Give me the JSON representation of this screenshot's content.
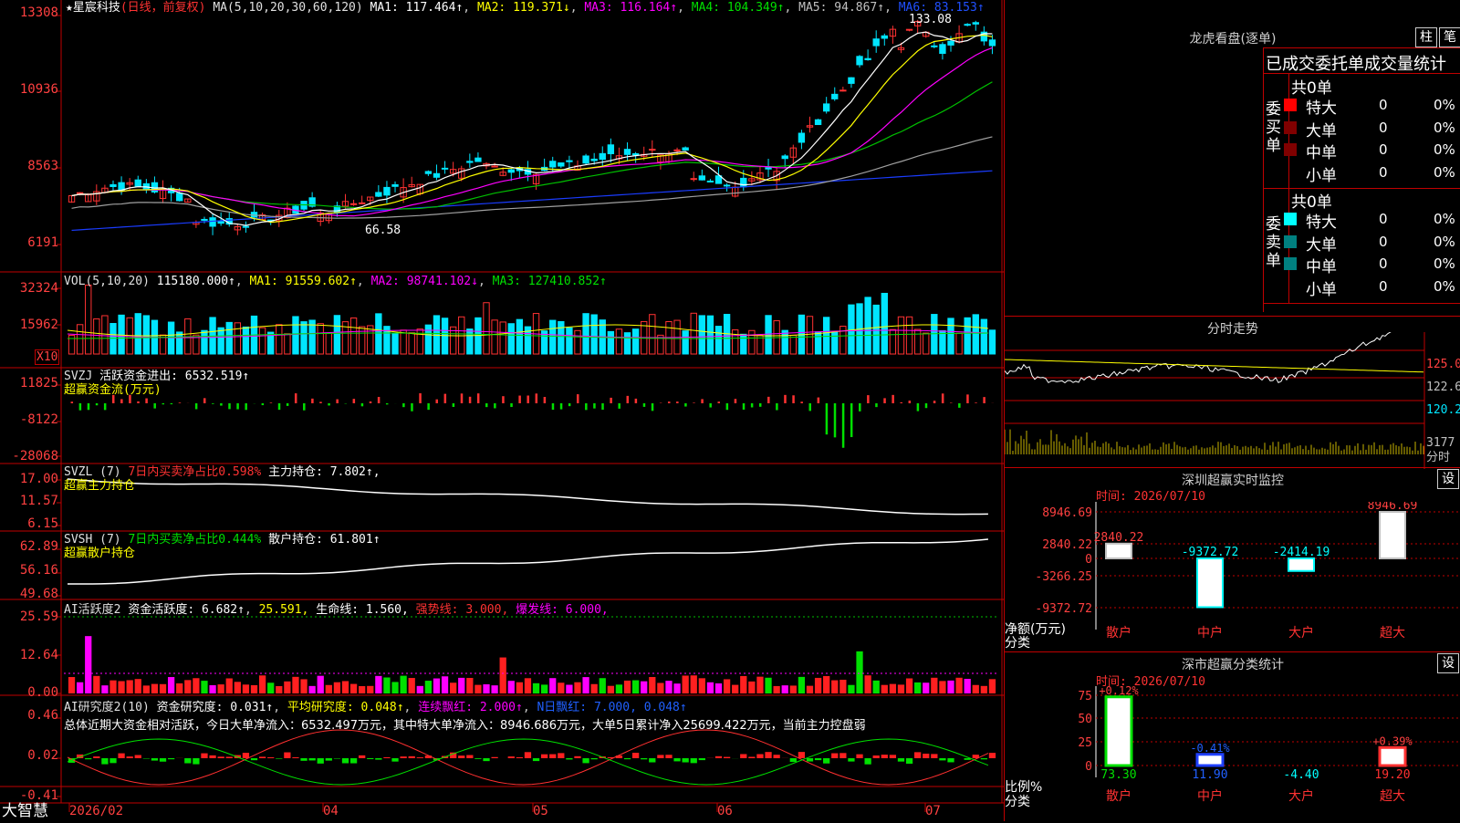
{
  "colors": {
    "up": "#ff3232",
    "down": "#00e5ff",
    "ma1": "#ffffff",
    "ma2": "#ffff00",
    "ma3": "#ff00ff",
    "ma4": "#00c000",
    "ma5": "#a0a0a0",
    "ma6": "#1a3cff",
    "axis": "#c00000"
  },
  "main": {
    "star": "★",
    "stock_name": "星宸科技",
    "period": "(日线，前复权)",
    "ma_label": "MA(5,10,20,30,60,120)",
    "ma_values": [
      "MA1: 117.464↑",
      "MA2: 119.371↓",
      "MA3: 116.164↑",
      "MA4: 104.349↑",
      "MA5: 94.867↑",
      "MA6: 83.153↑"
    ],
    "y_ticks": [
      "13308",
      "10936",
      "8563",
      "6191"
    ],
    "high_label": "133.08",
    "low_label": "66.58"
  },
  "vol": {
    "label": "VOL(5,10,20)",
    "values": [
      "115180.000↑",
      "MA1: 91559.602↑",
      "MA2: 98741.102↓",
      "MA3: 127410.852↑"
    ],
    "y_ticks": [
      "32324",
      "15962"
    ],
    "unit": "X10"
  },
  "svzj": {
    "label": "SVZJ",
    "title": "活跃资金进出: 6532.519↑",
    "sub": "超赢资金流(万元)",
    "y_ticks": [
      "11825",
      "-8122",
      "-28068"
    ]
  },
  "svzl": {
    "label": "SVZL (7)",
    "title_a": "7日内买卖净占比0.598%",
    "title_b": "主力持仓: 7.802↑,",
    "sub": "超赢主力持仓",
    "y_ticks": [
      "17.00",
      "11.57",
      "6.15"
    ]
  },
  "svsh": {
    "label": "SVSH (7)",
    "title_a": "7日内买卖净占比0.444%",
    "title_b": "散户持仓: 61.801↑",
    "sub": "超赢散户持仓",
    "y_ticks": [
      "62.89",
      "56.16",
      "49.68"
    ]
  },
  "ai1": {
    "label": "AI活跃度2",
    "a": "资金活跃度: 6.682↑",
    "b": "25.591,",
    "c": "生命线: 1.560,",
    "d": "强势线: 3.000,",
    "e": "爆发线: 6.000,",
    "y_ticks": [
      "25.59",
      "12.64",
      "0.00"
    ]
  },
  "ai2": {
    "label": "AI研究度2(10)",
    "a": "资金研究度: 0.031↑",
    "b": "平均研究度: 0.048↑",
    "c": "连续飘红: 2.000↑",
    "d": "N日飘红: 7.000, 0.048↑",
    "summary": "总体近期大资金相对活跃，今日大单净流入：6532.497万元，其中特大单净流入：8946.686万元，大单5日累计净入25699.422万元，当前主力控盘弱",
    "y_ticks": [
      "0.46",
      "0.02",
      "-0.41"
    ]
  },
  "bottom": {
    "brand": "大智慧",
    "dates": [
      "2026/02",
      "04",
      "05",
      "06",
      "07"
    ]
  },
  "dragon": {
    "title": "龙虎看盘(逐单)",
    "btn_a": "柱",
    "btn_b": "笔",
    "tabs": "已成交委托单成交量统计",
    "buy_label": "委买单",
    "sell_label": "委卖单",
    "buy_total": "共0单",
    "sell_total": "共0单",
    "buy_rows": [
      {
        "name": "特大",
        "n": "0",
        "pct": "0%"
      },
      {
        "name": "大单",
        "n": "0",
        "pct": "0%"
      },
      {
        "name": "中单",
        "n": "0",
        "pct": "0%"
      },
      {
        "name": "小单",
        "n": "0",
        "pct": "0%"
      }
    ],
    "sell_rows": [
      {
        "name": "特大",
        "n": "0",
        "pct": "0%"
      },
      {
        "name": "大单",
        "n": "0",
        "pct": "0%"
      },
      {
        "name": "中单",
        "n": "0",
        "pct": "0%"
      },
      {
        "name": "小单",
        "n": "0",
        "pct": "0%"
      }
    ]
  },
  "intraday": {
    "title": "分时走势",
    "y_ticks": [
      "125.0",
      "122.6",
      "120.2"
    ],
    "vol_tick": "3177",
    "vol_unit": "分时"
  },
  "monitor": {
    "title": "深圳超赢实时监控",
    "settings": "设",
    "time": "时间: 2026/07/10",
    "y_ticks": [
      "8946.69",
      "2840.22",
      "0",
      "-3266.25",
      "-9372.72"
    ],
    "ylabel": "净额(万元)",
    "xlabel": "分类",
    "categories": [
      "散户",
      "中户",
      "大户",
      "超大"
    ],
    "values": [
      "2840.22",
      "-9372.72",
      "-2414.19",
      "8946.69"
    ]
  },
  "classify": {
    "title": "深市超赢分类统计",
    "settings": "设",
    "time": "时间: 2026/07/10",
    "y_ticks": [
      "75",
      "50",
      "25",
      "0"
    ],
    "ylabel": "比例%",
    "xlabel": "分类",
    "categories": [
      "散户",
      "中户",
      "大户",
      "超大"
    ],
    "pct": [
      "+0.12%",
      "-0.41%",
      "",
      "+0.39%"
    ],
    "values": [
      "73.30",
      "11.90",
      "-4.40",
      "19.20"
    ]
  }
}
